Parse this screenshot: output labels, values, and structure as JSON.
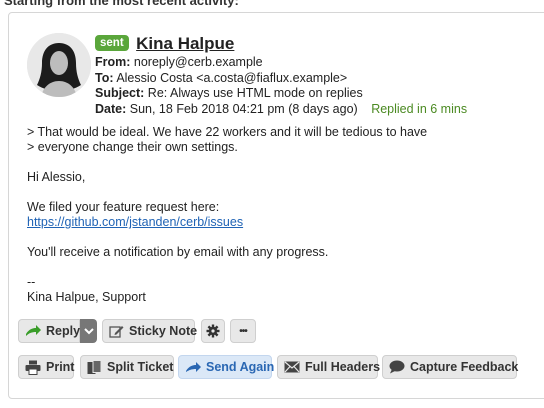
{
  "caption": "Starting from the most recent activity:",
  "message": {
    "badge": "sent",
    "sender": "Kina Halpue",
    "from_label": "From:",
    "from_value": "noreply@cerb.example",
    "to_label": "To:",
    "to_value": "Alessio Costa <a.costa@fiaflux.example>",
    "subject_label": "Subject:",
    "subject_value": "Re: Always use HTML mode on replies",
    "date_label": "Date:",
    "date_value": "Sun, 18 Feb 2018 04:21 pm",
    "date_ago": "(8 days ago)",
    "replied": "Replied in 6 mins",
    "body": {
      "quote1": "> That would be ideal. We have 22 workers and it will be tedious to have",
      "quote2": "> everyone change their own settings.",
      "greeting": "Hi Alessio,",
      "line1": "We filed your feature request here:",
      "link": "https://github.com/jstanden/cerb/issues",
      "line2": "You'll receive a notification by email with any progress.",
      "sig_dash": "--",
      "signature": "Kina Halpue, Support"
    }
  },
  "actions": {
    "reply": "Reply",
    "sticky_note": "Sticky Note",
    "more": "•••",
    "print": "Print",
    "split_ticket": "Split Ticket",
    "send_again": "Send Again",
    "full_headers": "Full Headers",
    "capture_feedback": "Capture Feedback"
  },
  "colors": {
    "badge": "#5aa63b",
    "link": "#1f63b5",
    "replied": "#4b8a22",
    "send_again": "#2a67b3"
  }
}
